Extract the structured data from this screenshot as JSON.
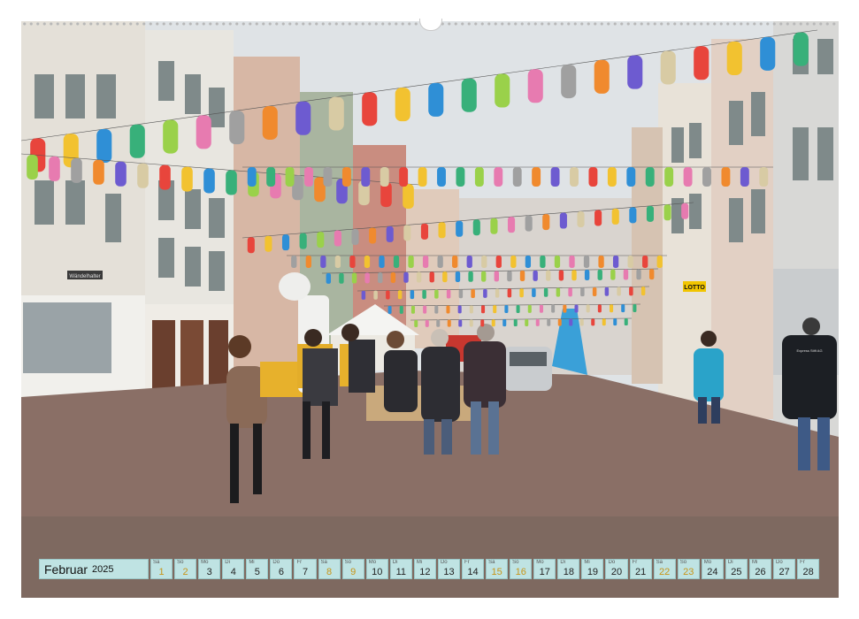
{
  "calendar": {
    "month": "Februar",
    "year": "2025",
    "days": [
      {
        "wd": "Sa",
        "n": "1",
        "we": true
      },
      {
        "wd": "So",
        "n": "2",
        "we": true
      },
      {
        "wd": "Mo",
        "n": "3",
        "we": false
      },
      {
        "wd": "Di",
        "n": "4",
        "we": false
      },
      {
        "wd": "Mi",
        "n": "5",
        "we": false
      },
      {
        "wd": "Do",
        "n": "6",
        "we": false
      },
      {
        "wd": "Fr",
        "n": "7",
        "we": false
      },
      {
        "wd": "Sa",
        "n": "8",
        "we": true
      },
      {
        "wd": "So",
        "n": "9",
        "we": true
      },
      {
        "wd": "Mo",
        "n": "10",
        "we": false
      },
      {
        "wd": "Di",
        "n": "11",
        "we": false
      },
      {
        "wd": "Mi",
        "n": "12",
        "we": false
      },
      {
        "wd": "Do",
        "n": "13",
        "we": false
      },
      {
        "wd": "Fr",
        "n": "14",
        "we": false
      },
      {
        "wd": "Sa",
        "n": "15",
        "we": true
      },
      {
        "wd": "So",
        "n": "16",
        "we": true
      },
      {
        "wd": "Mo",
        "n": "17",
        "we": false
      },
      {
        "wd": "Di",
        "n": "18",
        "we": false
      },
      {
        "wd": "Mi",
        "n": "19",
        "we": false
      },
      {
        "wd": "Do",
        "n": "20",
        "we": false
      },
      {
        "wd": "Fr",
        "n": "21",
        "we": false
      },
      {
        "wd": "Sa",
        "n": "22",
        "we": true
      },
      {
        "wd": "So",
        "n": "23",
        "we": true
      },
      {
        "wd": "Mo",
        "n": "24",
        "we": false
      },
      {
        "wd": "Di",
        "n": "25",
        "we": false
      },
      {
        "wd": "Mi",
        "n": "26",
        "we": false
      },
      {
        "wd": "Do",
        "n": "27",
        "we": false
      },
      {
        "wd": "Fr",
        "n": "28",
        "we": false
      }
    ]
  },
  "signs": {
    "shop_left": "Wändelhalter",
    "lotto": "LOTTO",
    "jacket_text": "Express Stift AG"
  },
  "colors": {
    "calendar_cell": "#bfe3e3",
    "weekend_number": "#c79518",
    "street": "#8a6f66",
    "sky": "#dfe3e6"
  }
}
